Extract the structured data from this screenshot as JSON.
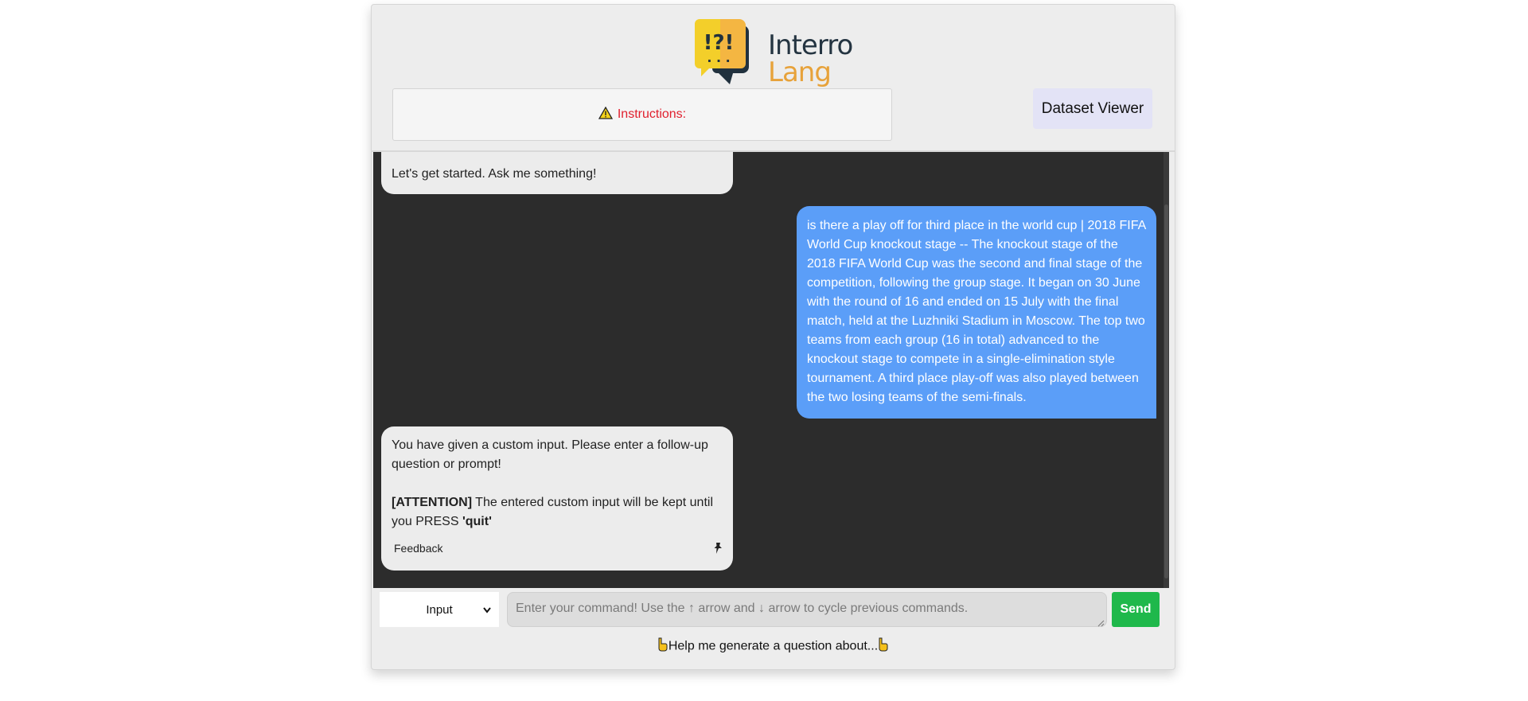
{
  "header": {
    "logo": {
      "glyph": "!?!",
      "line1": "Interro",
      "line2": "Lang"
    },
    "instructions_label": "Instructions:",
    "dataset_viewer_label": "Dataset Viewer"
  },
  "chat": {
    "messages": [
      {
        "role": "bot",
        "text": "Let's get started. Ask me something!"
      },
      {
        "role": "user",
        "text": "is there a play off for third place in the world cup | 2018 FIFA World Cup knockout stage -- The knockout stage of the 2018 FIFA World Cup was the second and final stage of the competition, following the group stage. It began on 30 June with the round of 16 and ended on 15 July with the final match, held at the Luzhniki Stadium in Moscow. The top two teams from each group (16 in total) advanced to the knockout stage to compete in a single-elimination style tournament. A third place play-off was also played between the two losing teams of the semi-finals."
      },
      {
        "role": "bot",
        "line1": "You have given a custom input. Please enter a follow-up question or prompt!",
        "attention": "[ATTENTION]",
        "line2": " The entered custom input will be kept until you PRESS ",
        "quit": "'quit'",
        "feedback": "Feedback"
      }
    ]
  },
  "input": {
    "mode_selected": "Input",
    "placeholder": "Enter your command! Use the ↑ arrow and ↓ arrow to cycle previous commands.",
    "send_label": "Send",
    "help_label": "Help me generate a question about..."
  },
  "colors": {
    "accent_user": "#5b9ef8",
    "send": "#1fb84b",
    "warning_text": "#e0202e",
    "chat_bg": "#2c2c2c"
  },
  "icons": [
    "warning-icon",
    "pin-icon",
    "chevron-down-icon",
    "pointing-hand-icon",
    "resize-grip-icon"
  ]
}
